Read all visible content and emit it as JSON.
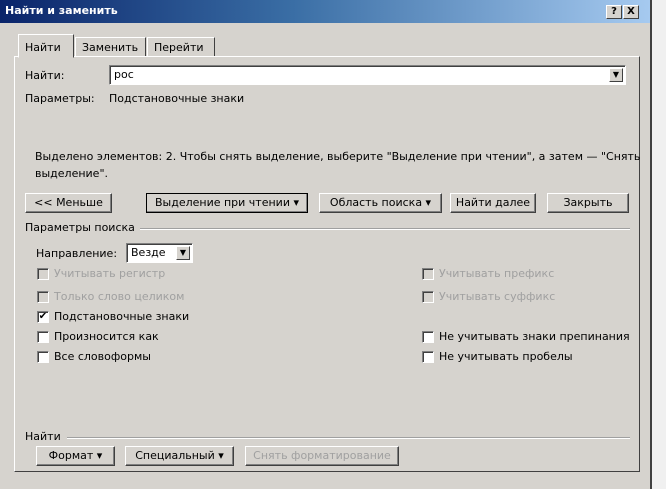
{
  "window": {
    "title": "Найти и заменить",
    "help": "?",
    "close": "X"
  },
  "tabs": [
    {
      "label": "Найти",
      "active": true
    },
    {
      "label": "Заменить"
    },
    {
      "label": "Перейти"
    }
  ],
  "find": {
    "label": "Найти:",
    "value": "рос"
  },
  "params": {
    "label": "Параметры:",
    "value": "Подстановочные знаки"
  },
  "message": {
    "line1": "Выделено элементов: 2. Чтобы снять выделение, выберите \"Выделение при чтении\", а затем — \"Снять",
    "line2": "выделение\"."
  },
  "buttons": {
    "less": "<< Меньше",
    "reading_highlight": "Выделение при чтении ▾",
    "find_in": "Область поиска ▾",
    "find_next": "Найти далее",
    "close": "Закрыть"
  },
  "search_options": {
    "title": "Параметры поиска",
    "direction_label": "Направление:",
    "direction_value": "Везде",
    "left": [
      {
        "label": "Учитывать регистр",
        "checked": false,
        "disabled": true
      },
      {
        "label": "Только слово целиком",
        "checked": false,
        "disabled": true
      },
      {
        "label": "Подстановочные знаки",
        "checked": true,
        "disabled": false
      },
      {
        "label": "Произносится как",
        "checked": false,
        "disabled": false
      },
      {
        "label": "Все словоформы",
        "checked": false,
        "disabled": false
      }
    ],
    "right": [
      {
        "label": "Учитывать префикс",
        "checked": false,
        "disabled": true
      },
      {
        "label": "Учитывать суффикс",
        "checked": false,
        "disabled": true
      },
      {
        "label": "Не учитывать знаки препинания",
        "checked": false,
        "disabled": false
      },
      {
        "label": "Не учитывать пробелы",
        "checked": false,
        "disabled": false
      }
    ]
  },
  "find_group": {
    "title": "Найти",
    "format": "Формат ▾",
    "special": "Специальный ▾",
    "no_formatting": "Снять форматирование"
  }
}
